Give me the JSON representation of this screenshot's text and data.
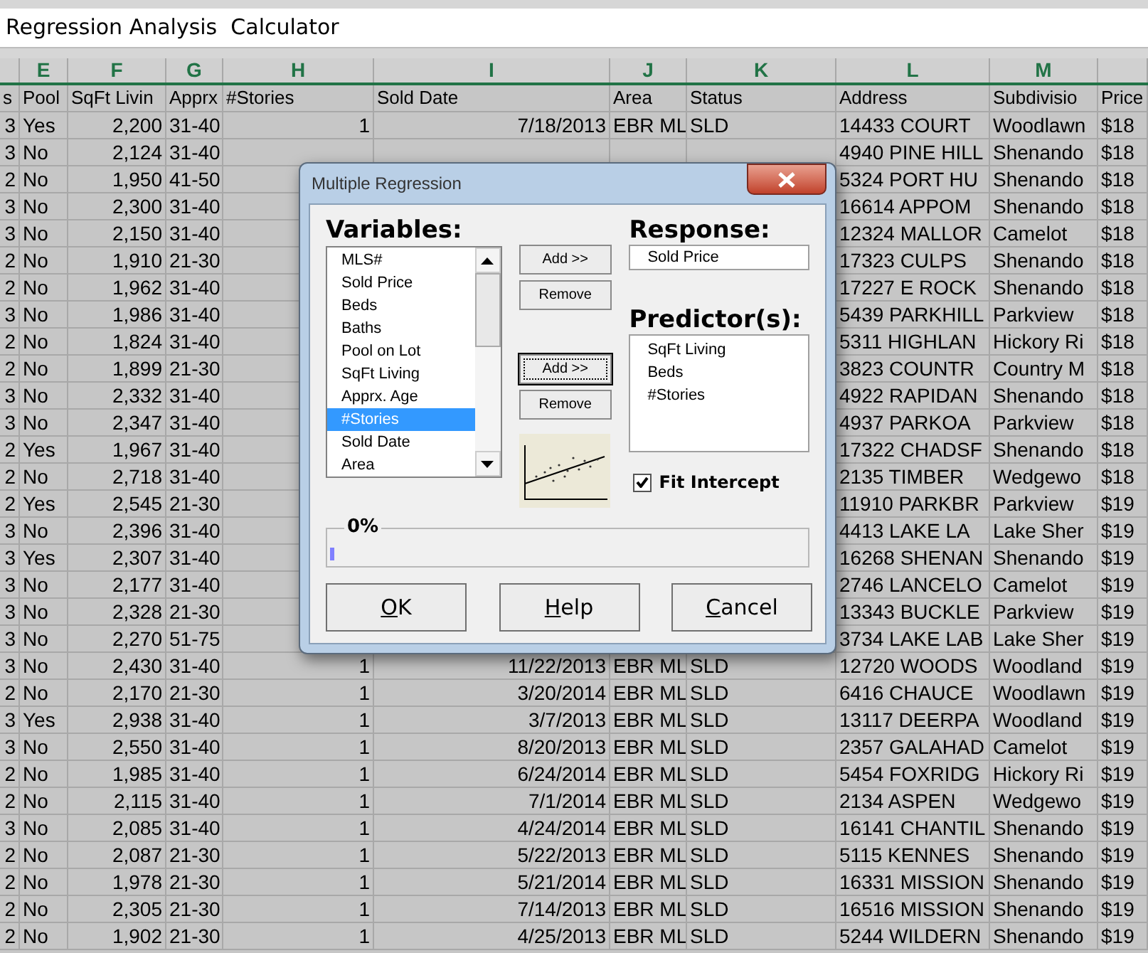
{
  "title": "Regression Analysis  Calculator",
  "columns": [
    {
      "header": "s"
    },
    {
      "letter": "E",
      "header": "Pool"
    },
    {
      "letter": "F",
      "header": "SqFt Livin"
    },
    {
      "letter": "G",
      "header": "Apprx"
    },
    {
      "letter": "H",
      "header": "#Stories"
    },
    {
      "letter": "I",
      "header": "Sold Date"
    },
    {
      "letter": "J",
      "header": "Area"
    },
    {
      "letter": "K",
      "header": "Status"
    },
    {
      "letter": "L",
      "header": "Address"
    },
    {
      "letter": "M",
      "header": "Subdivisio"
    },
    {
      "header": "Price"
    }
  ],
  "rows": [
    [
      "3",
      "Yes",
      "2,200",
      "31-40",
      "1",
      "7/18/2013",
      "EBR ML",
      "SLD",
      "14433 COURT",
      "Woodlawn",
      "$18"
    ],
    [
      "3",
      "No",
      "2,124",
      "31-40",
      null,
      null,
      null,
      null,
      "4940 PINE HILL",
      "Shenando",
      "$18"
    ],
    [
      "2",
      "No",
      "1,950",
      "41-50",
      null,
      null,
      null,
      null,
      "5324 PORT HU",
      "Shenando",
      "$18"
    ],
    [
      "3",
      "No",
      "2,300",
      "31-40",
      null,
      null,
      null,
      null,
      "16614 APPOM",
      "Shenando",
      "$18"
    ],
    [
      "3",
      "No",
      "2,150",
      "31-40",
      null,
      null,
      null,
      null,
      "12324 MALLOR",
      "Camelot",
      "$18"
    ],
    [
      "2",
      "No",
      "1,910",
      "21-30",
      null,
      null,
      null,
      null,
      "17323 CULPS",
      "Shenando",
      "$18"
    ],
    [
      "2",
      "No",
      "1,962",
      "31-40",
      null,
      null,
      null,
      null,
      "17227 E ROCK",
      "Shenando",
      "$18"
    ],
    [
      "3",
      "No",
      "1,986",
      "31-40",
      null,
      null,
      null,
      null,
      "5439 PARKHILL",
      "Parkview",
      "$18"
    ],
    [
      "2",
      "No",
      "1,824",
      "31-40",
      null,
      null,
      null,
      null,
      "5311 HIGHLAN",
      "Hickory Ri",
      "$18"
    ],
    [
      "2",
      "No",
      "1,899",
      "21-30",
      null,
      null,
      null,
      null,
      "3823 COUNTR",
      "Country M",
      "$18"
    ],
    [
      "3",
      "No",
      "2,332",
      "31-40",
      null,
      null,
      null,
      null,
      "4922 RAPIDAN",
      "Shenando",
      "$18"
    ],
    [
      "3",
      "No",
      "2,347",
      "31-40",
      null,
      null,
      null,
      null,
      "4937 PARKOA",
      "Parkview",
      "$18"
    ],
    [
      "2",
      "Yes",
      "1,967",
      "31-40",
      null,
      null,
      null,
      null,
      "17322 CHADSF",
      "Shenando",
      "$18"
    ],
    [
      "2",
      "No",
      "2,718",
      "31-40",
      null,
      null,
      null,
      null,
      "2135 TIMBER",
      "Wedgewo",
      "$18"
    ],
    [
      "2",
      "Yes",
      "2,545",
      "21-30",
      null,
      null,
      null,
      null,
      "11910 PARKBR",
      "Parkview",
      "$19"
    ],
    [
      "3",
      "No",
      "2,396",
      "31-40",
      null,
      null,
      null,
      null,
      "4413 LAKE LA",
      "Lake Sher",
      "$19"
    ],
    [
      "3",
      "Yes",
      "2,307",
      "31-40",
      null,
      null,
      null,
      null,
      "16268 SHENAN",
      "Shenando",
      "$19"
    ],
    [
      "3",
      "No",
      "2,177",
      "31-40",
      null,
      null,
      null,
      null,
      "2746 LANCELO",
      "Camelot",
      "$19"
    ],
    [
      "3",
      "No",
      "2,328",
      "21-30",
      null,
      null,
      null,
      null,
      "13343 BUCKLE",
      "Parkview",
      "$19"
    ],
    [
      "3",
      "No",
      "2,270",
      "51-75",
      null,
      null,
      null,
      null,
      "3734 LAKE LAB",
      "Lake Sher",
      "$19"
    ],
    [
      "3",
      "No",
      "2,430",
      "31-40",
      "1",
      "11/22/2013",
      "EBR ML",
      "SLD",
      "12720 WOODS",
      "Woodland",
      "$19"
    ],
    [
      "2",
      "No",
      "2,170",
      "21-30",
      "1",
      "3/20/2014",
      "EBR ML",
      "SLD",
      "6416 CHAUCE",
      "Woodlawn",
      "$19"
    ],
    [
      "3",
      "Yes",
      "2,938",
      "31-40",
      "1",
      "3/7/2013",
      "EBR ML",
      "SLD",
      "13117 DEERPA",
      "Woodland",
      "$19"
    ],
    [
      "3",
      "No",
      "2,550",
      "31-40",
      "1",
      "8/20/2013",
      "EBR ML",
      "SLD",
      "2357 GALAHAD",
      "Camelot",
      "$19"
    ],
    [
      "2",
      "No",
      "1,985",
      "31-40",
      "1",
      "6/24/2014",
      "EBR ML",
      "SLD",
      "5454 FOXRIDG",
      "Hickory Ri",
      "$19"
    ],
    [
      "2",
      "No",
      "2,115",
      "31-40",
      "1",
      "7/1/2014",
      "EBR ML",
      "SLD",
      "2134 ASPEN",
      "Wedgewo",
      "$19"
    ],
    [
      "3",
      "No",
      "2,085",
      "31-40",
      "1",
      "4/24/2014",
      "EBR ML",
      "SLD",
      "16141 CHANTIL",
      "Shenando",
      "$19"
    ],
    [
      "2",
      "No",
      "2,087",
      "21-30",
      "1",
      "5/22/2013",
      "EBR ML",
      "SLD",
      "5115 KENNES",
      "Shenando",
      "$19"
    ],
    [
      "2",
      "No",
      "1,978",
      "21-30",
      "1",
      "5/21/2014",
      "EBR ML",
      "SLD",
      "16331 MISSION",
      "Shenando",
      "$19"
    ],
    [
      "2",
      "No",
      "2,305",
      "21-30",
      "1",
      "7/14/2013",
      "EBR ML",
      "SLD",
      "16516 MISSION",
      "Shenando",
      "$19"
    ],
    [
      "2",
      "No",
      "1,902",
      "21-30",
      "1",
      "4/25/2013",
      "EBR ML",
      "SLD",
      "5244 WILDERN",
      "Shenando",
      "$19"
    ]
  ],
  "dialog": {
    "title": "Multiple Regression",
    "variables_label": "Variables:",
    "variables": [
      {
        "label": "MLS#",
        "selected": false
      },
      {
        "label": "Sold Price",
        "selected": false
      },
      {
        "label": "Beds",
        "selected": false
      },
      {
        "label": "Baths",
        "selected": false
      },
      {
        "label": "Pool on Lot",
        "selected": false
      },
      {
        "label": "SqFt Living",
        "selected": false
      },
      {
        "label": "Apprx. Age",
        "selected": false
      },
      {
        "label": "#Stories",
        "selected": true
      },
      {
        "label": "Sold Date",
        "selected": false
      },
      {
        "label": "Area",
        "selected": false
      }
    ],
    "response_buttons": [
      {
        "label": "Add >>",
        "focused": false
      },
      {
        "label": "Remove",
        "focused": false
      }
    ],
    "predictor_buttons": [
      {
        "label": "Add >>",
        "focused": true
      },
      {
        "label": "Remove",
        "focused": false
      }
    ],
    "response_label": "Response:",
    "response_value": "Sold Price",
    "predictors_label": "Predictor(s):",
    "predictors": [
      "SqFt Living",
      "Beds",
      "#Stories"
    ],
    "fit_intercept": {
      "label": "Fit Intercept",
      "checked": true
    },
    "progress": {
      "label": "0%",
      "level": 0
    },
    "buttons": [
      {
        "label": "OK",
        "underline_first": true
      },
      {
        "label": "Help",
        "underline_first": true
      },
      {
        "label": "Cancel",
        "underline_first": true
      }
    ]
  }
}
